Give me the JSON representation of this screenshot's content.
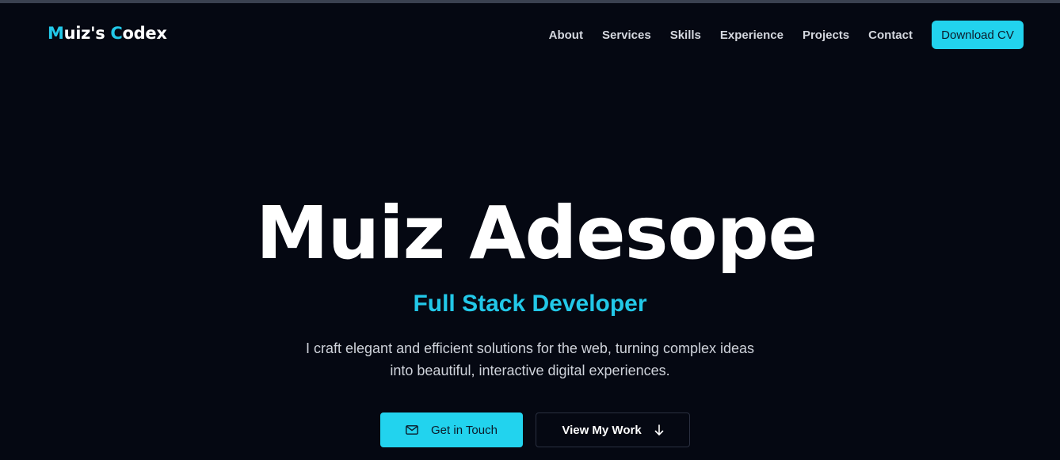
{
  "header": {
    "logo": {
      "part1": "M",
      "part2": "uiz's ",
      "part3": "C",
      "part4": "odex"
    },
    "nav": [
      "About",
      "Services",
      "Skills",
      "Experience",
      "Projects",
      "Contact"
    ],
    "download_cv": "Download CV"
  },
  "hero": {
    "name": "Muiz Adesope",
    "role": "Full Stack Developer",
    "description": "I craft elegant and efficient solutions for the web, turning complex ideas into beautiful, interactive digital experiences.",
    "primary_cta": "Get in Touch",
    "secondary_cta": "View My Work"
  },
  "icons": {
    "primary_cta_icon": "mail-icon",
    "secondary_cta_icon": "arrow-down-icon"
  },
  "colors": {
    "background": "#050812",
    "accent": "#22d3ee",
    "text": "#ffffff",
    "muted_text": "#cfd3db"
  }
}
